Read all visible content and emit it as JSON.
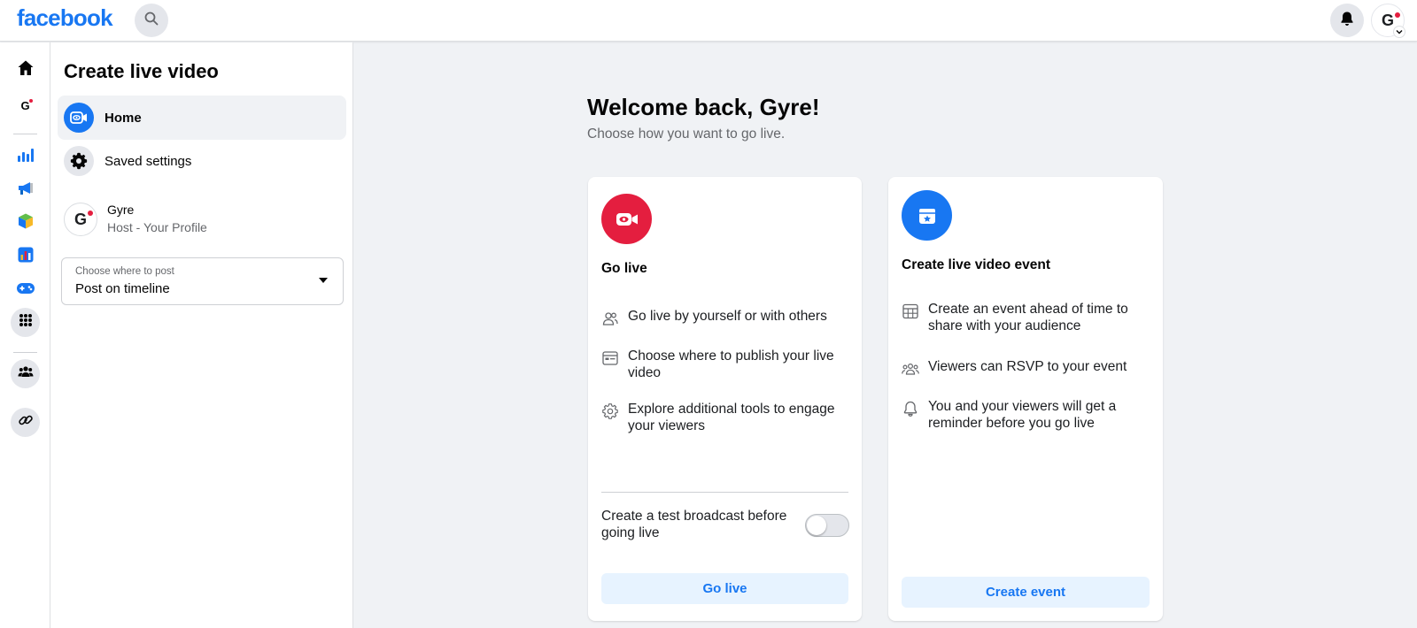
{
  "app": {
    "logo": "facebook"
  },
  "colors": {
    "brand": "#1877f2",
    "go_live_red": "#e41e3f",
    "action_bg": "#e7f3ff"
  },
  "header": {
    "icons": [
      "search-icon",
      "bell-icon",
      "account-avatar"
    ],
    "avatar_letter": "G"
  },
  "rail": {
    "icons": [
      "home-icon",
      "page-avatar",
      "insights-icon",
      "ads-icon",
      "box-icon",
      "chart-app-icon",
      "gaming-icon",
      "grid-menu-icon",
      "groups-icon",
      "link-icon"
    ],
    "avatar_letter": "G"
  },
  "panel": {
    "title": "Create live video",
    "nav": [
      {
        "label": "Home",
        "icon": "live-video-icon",
        "active": true
      },
      {
        "label": "Saved settings",
        "icon": "gear-icon",
        "active": false
      }
    ],
    "profile": {
      "name": "Gyre",
      "role": "Host - Your Profile",
      "avatar_letter": "G"
    },
    "post_select": {
      "label": "Choose where to post",
      "value": "Post on timeline"
    }
  },
  "main": {
    "welcome": "Welcome back, Gyre!",
    "subtitle": "Choose how you want to go live.",
    "go_live_card": {
      "title": "Go live",
      "features": [
        {
          "icon": "people-icon",
          "text": "Go live by yourself or with others"
        },
        {
          "icon": "window-icon",
          "text": "Choose where to publish your live video"
        },
        {
          "icon": "gear-outline-icon",
          "text": "Explore additional tools to engage your viewers"
        }
      ],
      "toggle_label": "Create a test broadcast before going live",
      "toggle_on": false,
      "button": "Go live"
    },
    "event_card": {
      "title": "Create live video event",
      "features": [
        {
          "icon": "calendar-grid-icon",
          "text": "Create an event ahead of time to share with your audience"
        },
        {
          "icon": "group-icon",
          "text": "Viewers can RSVP to your event"
        },
        {
          "icon": "bell-outline-icon",
          "text": "You and your viewers will get a reminder before you go live"
        }
      ],
      "button": "Create event"
    }
  }
}
